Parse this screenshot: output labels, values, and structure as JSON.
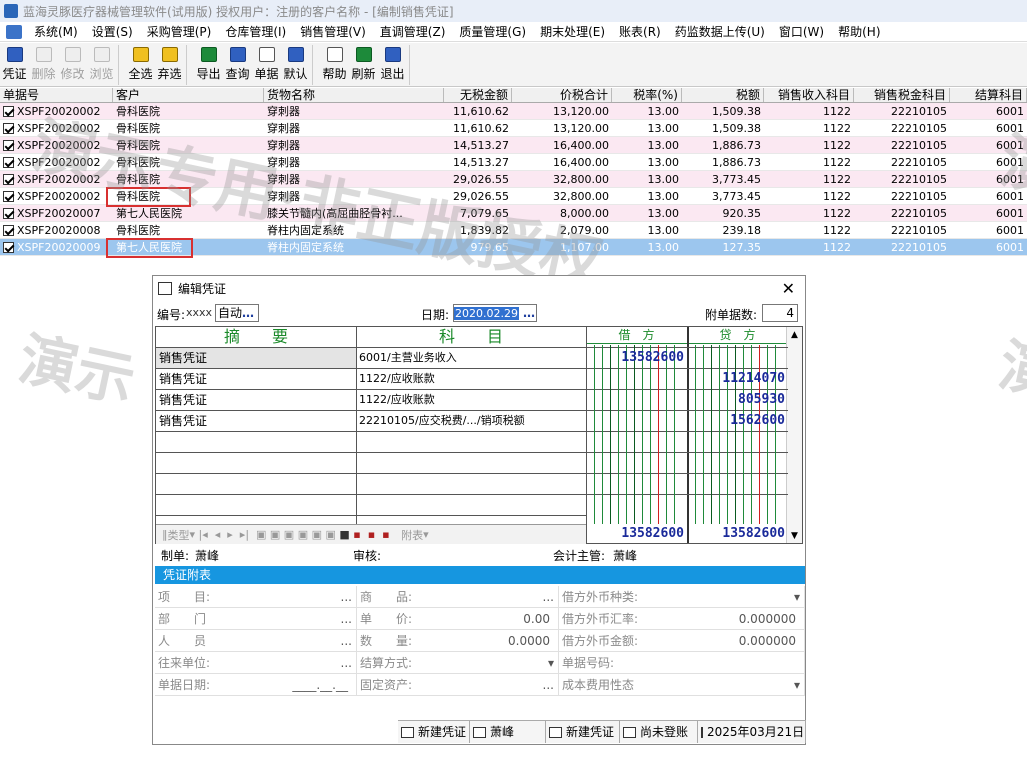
{
  "window": {
    "title": "蓝海灵豚医疗器械管理软件(试用版)   授权用户：注册的客户名称 - [编制销售凭证]"
  },
  "menu": [
    "系统(M)",
    "设置(S)",
    "采购管理(P)",
    "仓库管理(I)",
    "销售管理(V)",
    "直调管理(Z)",
    "质量管理(G)",
    "期末处理(E)",
    "账表(R)",
    "药监数据上传(U)",
    "窗口(W)",
    "帮助(H)"
  ],
  "toolbar": [
    {
      "label": "凭证",
      "enabled": true,
      "icon": "voucher-icon"
    },
    {
      "label": "删除",
      "enabled": false,
      "icon": "delete-icon"
    },
    {
      "label": "修改",
      "enabled": false,
      "icon": "edit-icon"
    },
    {
      "label": "浏览",
      "enabled": false,
      "icon": "browse-icon"
    },
    {
      "label": "全选",
      "enabled": true,
      "icon": "select-all-icon"
    },
    {
      "label": "弃选",
      "enabled": true,
      "icon": "deselect-icon"
    },
    {
      "label": "导出",
      "enabled": true,
      "icon": "export-icon"
    },
    {
      "label": "查询",
      "enabled": true,
      "icon": "query-icon"
    },
    {
      "label": "单据",
      "enabled": true,
      "icon": "document-icon"
    },
    {
      "label": "默认",
      "enabled": true,
      "icon": "default-icon"
    },
    {
      "label": "帮助",
      "enabled": true,
      "icon": "help-icon"
    },
    {
      "label": "刷新",
      "enabled": true,
      "icon": "refresh-icon"
    },
    {
      "label": "退出",
      "enabled": true,
      "icon": "exit-icon"
    }
  ],
  "grid": {
    "headers": [
      "单据号",
      "客户",
      "货物名称",
      "无税金额",
      "价税合计",
      "税率(%)",
      "税额",
      "销售收入科目",
      "销售税金科目",
      "结算科目"
    ],
    "rows": [
      [
        "XSPF20020002",
        "骨科医院",
        "穿刺器",
        "11,610.62",
        "13,120.00",
        "13.00",
        "1,509.38",
        "1122",
        "22210105",
        "6001"
      ],
      [
        "XSPF20020002",
        "骨科医院",
        "穿刺器",
        "11,610.62",
        "13,120.00",
        "13.00",
        "1,509.38",
        "1122",
        "22210105",
        "6001"
      ],
      [
        "XSPF20020002",
        "骨科医院",
        "穿刺器",
        "14,513.27",
        "16,400.00",
        "13.00",
        "1,886.73",
        "1122",
        "22210105",
        "6001"
      ],
      [
        "XSPF20020002",
        "骨科医院",
        "穿刺器",
        "14,513.27",
        "16,400.00",
        "13.00",
        "1,886.73",
        "1122",
        "22210105",
        "6001"
      ],
      [
        "XSPF20020002",
        "骨科医院",
        "穿刺器",
        "29,026.55",
        "32,800.00",
        "13.00",
        "3,773.45",
        "1122",
        "22210105",
        "6001"
      ],
      [
        "XSPF20020002",
        "骨科医院",
        "穿刺器",
        "29,026.55",
        "32,800.00",
        "13.00",
        "3,773.45",
        "1122",
        "22210105",
        "6001"
      ],
      [
        "XSPF20020007",
        "第七人民医院",
        "膝关节髓内(高屈曲胫骨衬...",
        "7,079.65",
        "8,000.00",
        "13.00",
        "920.35",
        "1122",
        "22210105",
        "6001"
      ],
      [
        "XSPF20020008",
        "骨科医院",
        "脊柱内固定系统",
        "1,839.82",
        "2,079.00",
        "13.00",
        "239.18",
        "1122",
        "22210105",
        "6001"
      ],
      [
        "XSPF20020009",
        "第七人民医院",
        "脊柱内固定系统",
        "979.65",
        "1,107.00",
        "13.00",
        "127.35",
        "1122",
        "22210105",
        "6001"
      ]
    ]
  },
  "watermark": {
    "line1": "演示专用·非正版授权",
    "line2": "演示"
  },
  "dialog": {
    "title": "编辑凭证",
    "number_label": "编号:",
    "number_value": "xxxx",
    "mode": "自动",
    "date_label": "日期:",
    "date_value": "2020.02.29",
    "attach_label": "附单据数:",
    "attach_value": "4",
    "col_summary": "摘　　要",
    "col_account": "科　　目",
    "col_debit": "借　方",
    "col_credit": "贷　方",
    "entries": [
      {
        "summary": "销售凭证",
        "account": "6001/主营业务收入",
        "debit": "13582600",
        "credit": ""
      },
      {
        "summary": "销售凭证",
        "account": "1122/应收账款",
        "debit": "",
        "credit": "11214070"
      },
      {
        "summary": "销售凭证",
        "account": "1122/应收账款",
        "debit": "",
        "credit": "805930"
      },
      {
        "summary": "销售凭证",
        "account": "22210105/应交税费/.../销项税额",
        "debit": "",
        "credit": "1562600"
      }
    ],
    "total_debit": "13582600",
    "total_credit": "13582600",
    "nav_type": "类型",
    "nav_attach": "附表",
    "maker_label": "制单:",
    "maker": "萧峰",
    "review_label": "审核:",
    "accountant_label": "会计主管:",
    "accountant": "萧峰",
    "attach_bar": "凭证附表",
    "fields": [
      [
        {
          "label": "项　　目:",
          "value": "",
          "more": "..."
        },
        {
          "label": "商　　品:",
          "value": "",
          "more": "..."
        },
        {
          "label": "借方外币种类:",
          "value": "",
          "more": "▾"
        }
      ],
      [
        {
          "label": "部　　门",
          "value": "",
          "more": "..."
        },
        {
          "label": "单　　价:",
          "value": "0.00",
          "more": ""
        },
        {
          "label": "借方外币汇率:",
          "value": "0.000000",
          "more": ""
        }
      ],
      [
        {
          "label": "人　　员",
          "value": "",
          "more": "..."
        },
        {
          "label": "数　　量:",
          "value": "0.0000",
          "more": ""
        },
        {
          "label": "借方外币金额:",
          "value": "0.000000",
          "more": ""
        }
      ],
      [
        {
          "label": "往来单位:",
          "value": "",
          "more": "..."
        },
        {
          "label": "结算方式:",
          "value": "",
          "more": "▾"
        },
        {
          "label": "单据号码:",
          "value": "",
          "more": ""
        }
      ],
      [
        {
          "label": "单据日期:",
          "value": "____.__.__",
          "more": ""
        },
        {
          "label": "固定资产:",
          "value": "",
          "more": "..."
        },
        {
          "label": "成本费用性态",
          "value": "",
          "more": "▾"
        }
      ]
    ],
    "status": [
      "新建凭证",
      "萧峰",
      "新建凭证",
      "尚未登账",
      "2025年03月21日"
    ]
  }
}
